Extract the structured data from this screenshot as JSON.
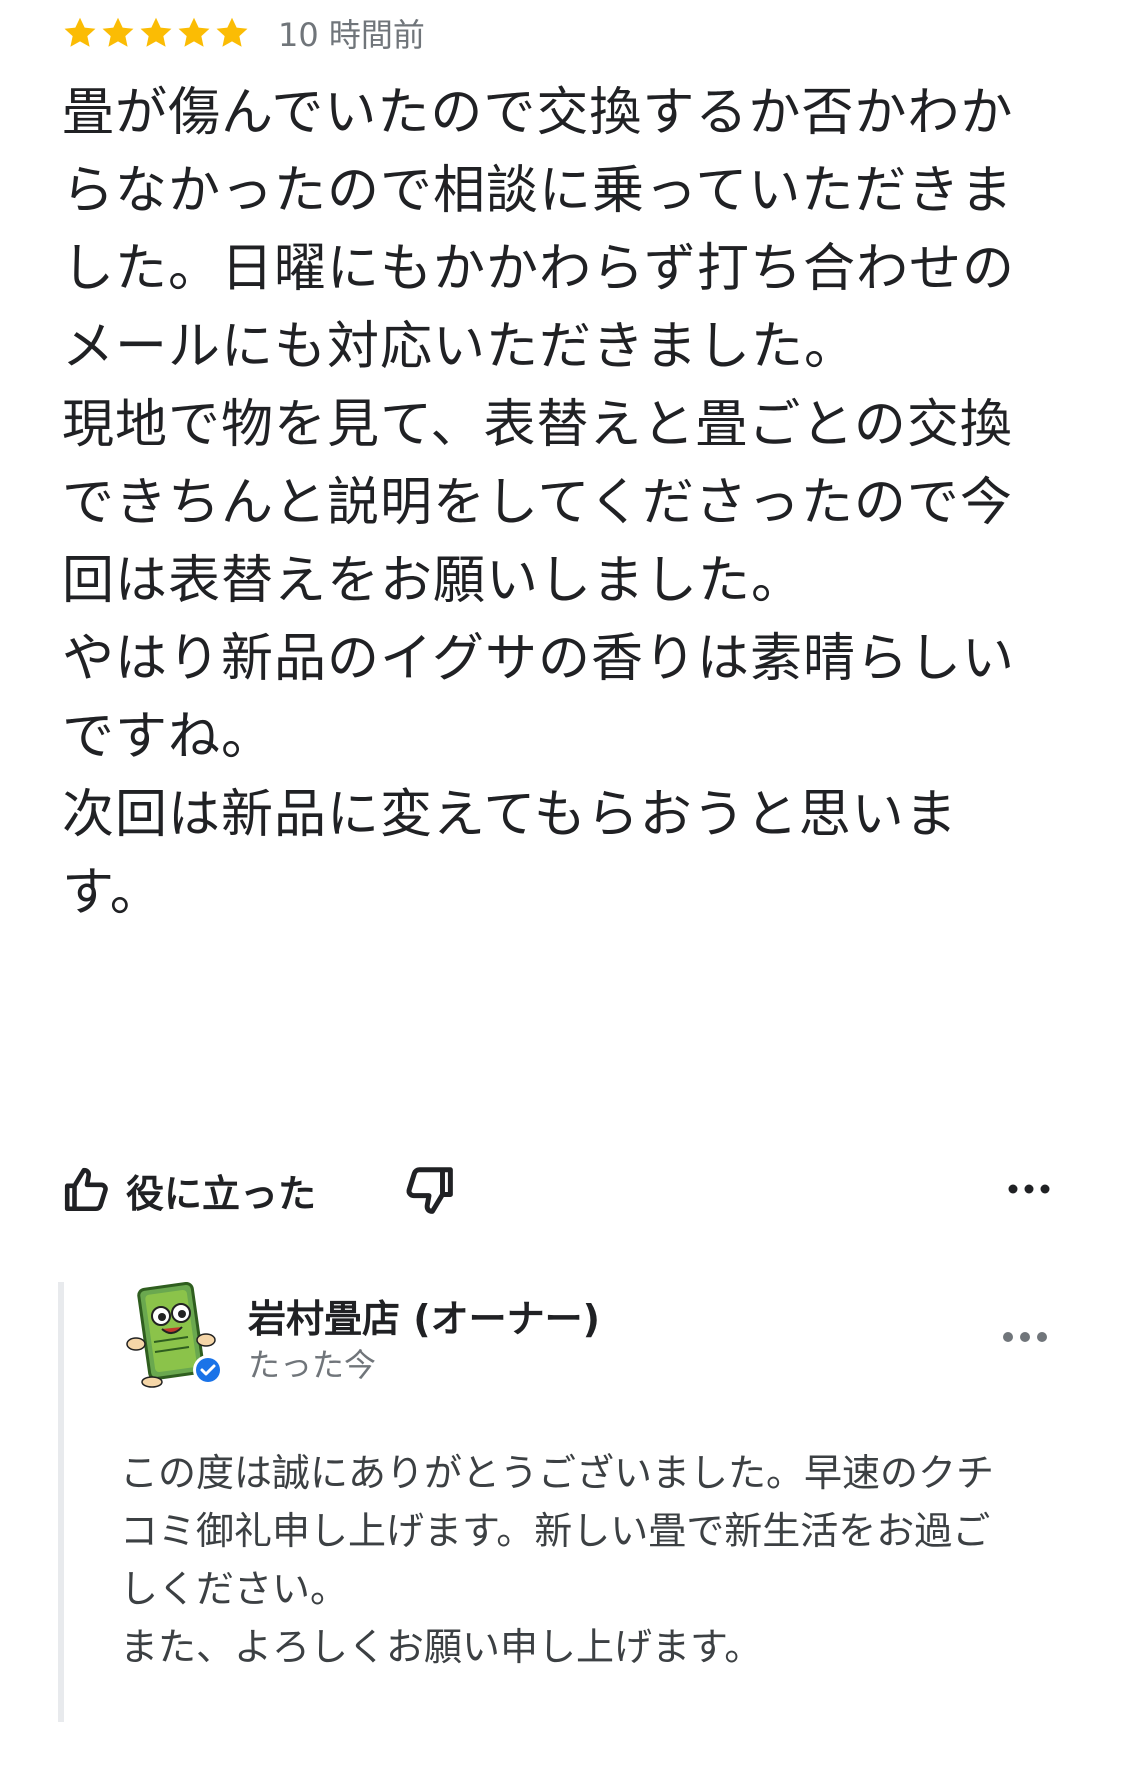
{
  "review": {
    "rating": 5,
    "rating_max": 5,
    "star_color": "#FBBC04",
    "time_ago": "10 時間前",
    "paragraphs": [
      "畳が傷んでいたので交換するか否かわからなかったので相談に乗っていただきました。日曜にもかかわらず打ち合わせのメールにも対応いただきました。",
      "現地で物を見て、表替えと畳ごとの交換できちんと説明をしてくださったので今回は表替えをお願いしました。",
      "やはり新品のイグサの香りは素晴らしいですね。",
      "次回は新品に変えてもらおうと思います。"
    ]
  },
  "actions": {
    "helpful_label": "役に立った",
    "helpful_icon": "thumbs-up-icon",
    "not_helpful_icon": "thumbs-down-icon",
    "more_icon": "more-horizontal-icon"
  },
  "owner_reply": {
    "name": "岩村畳店 (オーナー)",
    "time": "たった今",
    "verified_color": "#1a73e8",
    "avatar_icon": "tatami-mascot-avatar",
    "paragraphs": [
      "この度は誠にありがとうございました。早速のクチコミ御礼申し上げます。新しい畳で新生活をお過ごしください。",
      "また、よろしくお願い申し上げます。"
    ],
    "more_icon": "more-horizontal-icon"
  }
}
